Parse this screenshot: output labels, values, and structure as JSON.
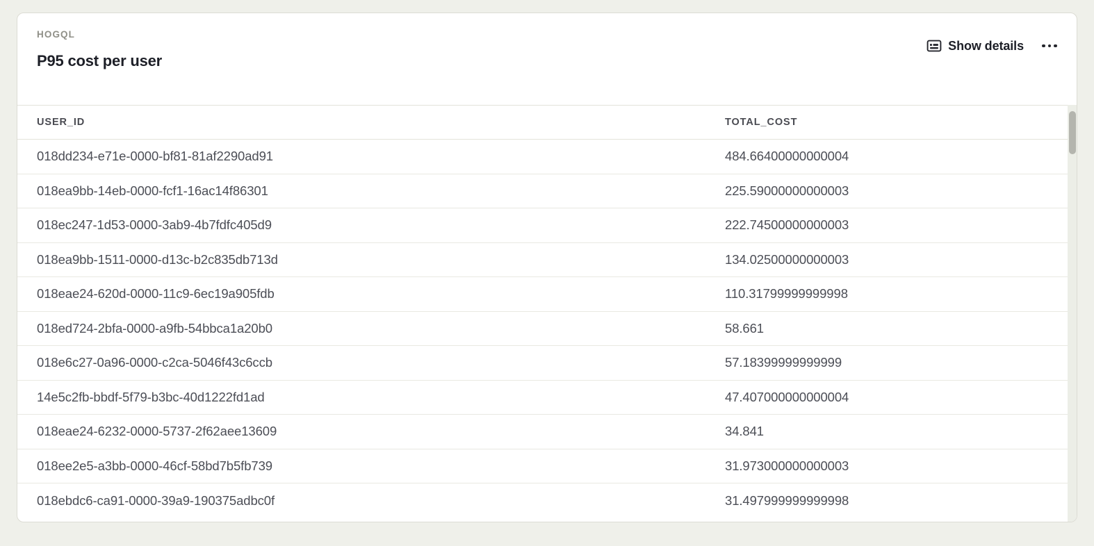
{
  "card": {
    "kicker": "HOGQL",
    "title": "P95 cost per user",
    "actions": {
      "show_details_label": "Show details",
      "show_details_icon": "details-card-icon",
      "more_menu_icon": "ellipsis-horizontal-icon"
    }
  },
  "table": {
    "columns": [
      {
        "key": "user_id",
        "label": "USER_ID"
      },
      {
        "key": "total_cost",
        "label": "TOTAL_COST"
      }
    ],
    "rows": [
      {
        "user_id": "018dd234-e71e-0000-bf81-81af2290ad91",
        "total_cost": "484.66400000000004"
      },
      {
        "user_id": "018ea9bb-14eb-0000-fcf1-16ac14f86301",
        "total_cost": "225.59000000000003"
      },
      {
        "user_id": "018ec247-1d53-0000-3ab9-4b7fdfc405d9",
        "total_cost": "222.74500000000003"
      },
      {
        "user_id": "018ea9bb-1511-0000-d13c-b2c835db713d",
        "total_cost": "134.02500000000003"
      },
      {
        "user_id": "018eae24-620d-0000-11c9-6ec19a905fdb",
        "total_cost": "110.31799999999998"
      },
      {
        "user_id": "018ed724-2bfa-0000-a9fb-54bbca1a20b0",
        "total_cost": "58.661"
      },
      {
        "user_id": "018e6c27-0a96-0000-c2ca-5046f43c6ccb",
        "total_cost": "57.18399999999999"
      },
      {
        "user_id": "14e5c2fb-bbdf-5f79-b3bc-40d1222fd1ad",
        "total_cost": "47.407000000000004"
      },
      {
        "user_id": "018eae24-6232-0000-5737-2f62aee13609",
        "total_cost": "34.841"
      },
      {
        "user_id": "018ee2e5-a3bb-0000-46cf-58bd7b5fb739",
        "total_cost": "31.973000000000003"
      },
      {
        "user_id": "018ebdc6-ca91-0000-39a9-190375adbc0f",
        "total_cost": "31.497999999999998"
      }
    ]
  },
  "scrollbar": {
    "orientation": "vertical"
  },
  "colors": {
    "page_background": "#eff0ea",
    "card_background": "#ffffff",
    "card_border": "#dcdcd4",
    "row_divider": "#e9e9e2",
    "title_text": "#1d1f27",
    "kicker_text": "#8f8f87",
    "header_text": "#4a4b52",
    "cell_text": "#4c4e56",
    "scrollbar_thumb": "#b4b5ae",
    "scrollbar_track": "#eceee7"
  }
}
